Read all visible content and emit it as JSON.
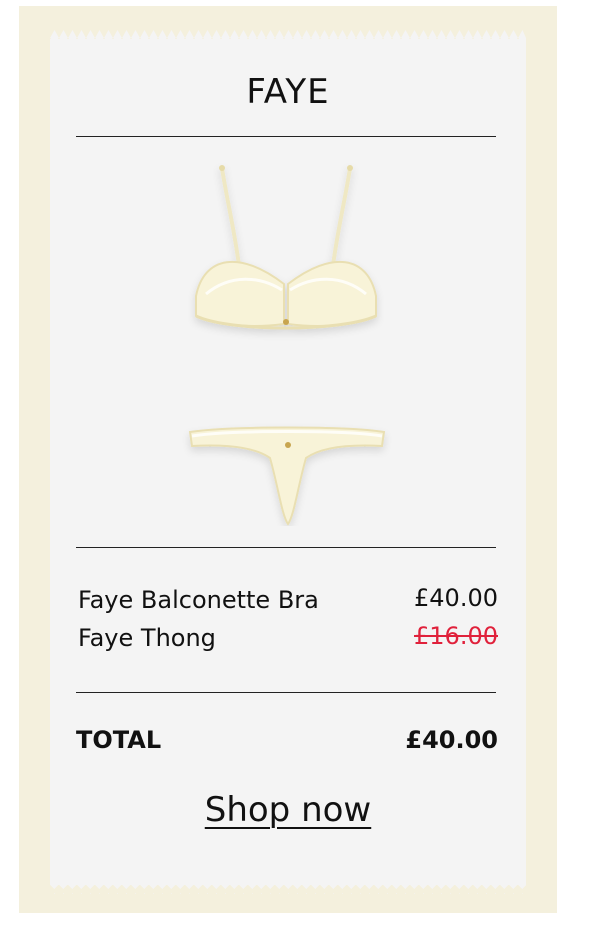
{
  "header": {
    "title": "FAYE"
  },
  "product": {
    "image_icon": "lingerie-set-image"
  },
  "items": [
    {
      "name": "Faye Balconette Bra",
      "price": "£40.00",
      "struck": false
    },
    {
      "name": "Faye Thong",
      "price": "£16.00",
      "struck": true
    }
  ],
  "total": {
    "label": "TOTAL",
    "value": "£40.00"
  },
  "cta": {
    "label": "Shop now"
  },
  "colors": {
    "frame": "#f4f0dd",
    "receipt": "#f4f4f4",
    "strike_price": "#e0213b",
    "text": "#111111"
  }
}
